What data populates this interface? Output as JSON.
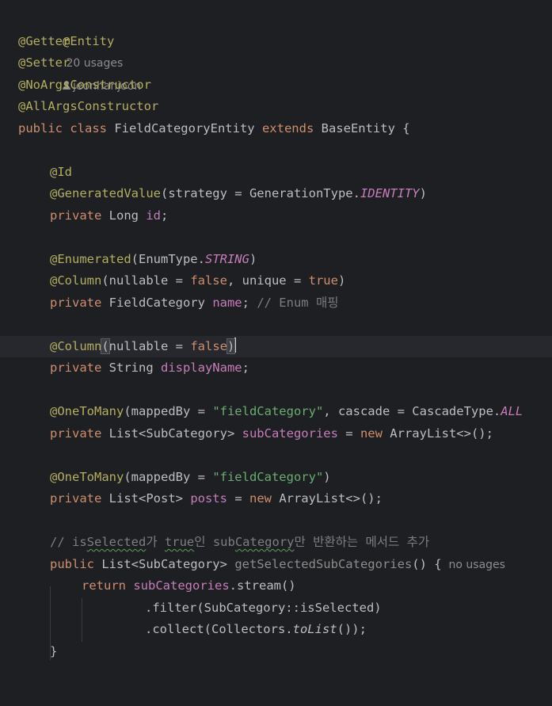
{
  "hints": {
    "class_usages": "20 usages",
    "class_author": "jeonhanjoon",
    "method_usages": "no usages"
  },
  "code": {
    "l1_ann": "@Entity",
    "l2": "@Getter",
    "l3": "@Setter",
    "l4": "@NoArgsConstructor",
    "l5": "@AllArgsConstructor",
    "l6_kw": "public class",
    "l6_name": " FieldCategoryEntity ",
    "l6_kw2": "extends",
    "l6_rest": " BaseEntity {",
    "l8": "@Id",
    "l9_ann": "@GeneratedValue",
    "l9_a": "(strategy = GenerationType.",
    "l9_enum": "IDENTITY",
    "l9_b": ")",
    "l10_kw": "private",
    "l10_type": " Long ",
    "l10_fld": "id",
    "l10_end": ";",
    "l12_ann": "@Enumerated",
    "l12_a": "(EnumType.",
    "l12_enum": "STRING",
    "l12_b": ")",
    "l13_ann": "@Column",
    "l13_a": "(nullable = ",
    "l13_f": "false",
    "l13_b": ", unique = ",
    "l13_t": "true",
    "l13_c": ")",
    "l14_kw": "private",
    "l14_type": " FieldCategory ",
    "l14_fld": "name",
    "l14_end": "; ",
    "l14_cmt": "// Enum 매핑",
    "l16_ann": "@Column",
    "l16_open": "(",
    "l16_a": "nullable = ",
    "l16_f": "false",
    "l16_close": ")",
    "l17_kw": "private",
    "l17_type": " String ",
    "l17_fld": "displayName",
    "l17_end": ";",
    "l19_ann": "@OneToMany",
    "l19_a": "(mappedBy = ",
    "l19_str": "\"fieldCategory\"",
    "l19_b": ", cascade = CascadeType.",
    "l19_enum": "ALL",
    "l20_kw": "private",
    "l20_type": " List<SubCategory> ",
    "l20_fld": "subCategories",
    "l20_eq": " = ",
    "l20_new": "new",
    "l20_rest": " ArrayList<>();",
    "l22_ann": "@OneToMany",
    "l22_a": "(mappedBy = ",
    "l22_str": "\"fieldCategory\"",
    "l22_b": ")",
    "l23_kw": "private",
    "l23_type": " List<Post> ",
    "l23_fld": "posts",
    "l23_eq": " = ",
    "l23_new": "new",
    "l23_rest": " ArrayList<>();",
    "l25_c1": "// is",
    "l25_c2": "Selected",
    "l25_c3": "가 ",
    "l25_c4": "true",
    "l25_c5": "인 sub",
    "l25_c6": "Category",
    "l25_c7": "만 반환하는 메서드 추가",
    "l26_kw": "public",
    "l26_type": " List<SubCategory> ",
    "l26_mth": "getSelectedSubCategories",
    "l26_rest": "() {",
    "l27_kw": "return",
    "l27_fld": " subCategories",
    "l27_rest": ".stream()",
    "l28": ".filter(SubCategory::isSelected)",
    "l29_a": ".collect(Collectors.",
    "l29_i": "toList",
    "l29_b": "());",
    "l30": "}"
  }
}
